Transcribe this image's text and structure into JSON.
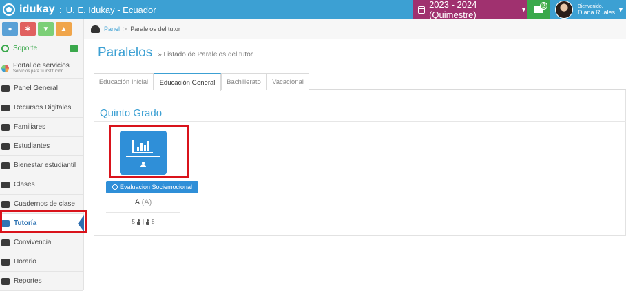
{
  "app": {
    "brand": "idukay",
    "separator": ":",
    "school": "U. E. Idukay - Ecuador"
  },
  "topbar": {
    "period_label": "2023 - 2024 (Quimestre)",
    "messages_badge": "2",
    "welcome": "Bienvenido,",
    "user_name": "Diana Ruales"
  },
  "sidebar": {
    "support": "Soporte",
    "portal_title": "Portal de servicios",
    "portal_subtitle": "Servicios para tu institución",
    "items": [
      {
        "label": "Panel General",
        "icon": "dashboard-icon"
      },
      {
        "label": "Recursos Digitales",
        "icon": "laptop-icon"
      },
      {
        "label": "Familiares",
        "icon": "user-icon"
      },
      {
        "label": "Estudiantes",
        "icon": "student-icon"
      },
      {
        "label": "Bienestar estudiantil",
        "icon": "student-wellbeing-icon"
      },
      {
        "label": "Clases",
        "icon": "flask-icon"
      },
      {
        "label": "Cuadernos de clase",
        "icon": "notebook-icon"
      },
      {
        "label": "Tutoría",
        "icon": "thumbs-up-icon"
      },
      {
        "label": "Convivencia",
        "icon": "conduct-icon"
      },
      {
        "label": "Horario",
        "icon": "calendar-icon"
      },
      {
        "label": "Reportes",
        "icon": "bar-chart-icon"
      }
    ]
  },
  "breadcrumb": {
    "home": "Panel",
    "separator": ">",
    "current": "Paralelos del tutor"
  },
  "page": {
    "title": "Paralelos",
    "subtitle": "» Listado de Paralelos del tutor"
  },
  "tabs": [
    "Educación Inicial",
    "Educación General",
    "Bachillerato",
    "Vacacional"
  ],
  "grade": {
    "title": "Quinto Grado",
    "button": "Evaluacion Sociemocional",
    "section_name": "A",
    "section_code": "(A)",
    "count_male": "5",
    "count_sep": "|",
    "count_female": "8"
  },
  "colors": {
    "topbar": "#3ca0d3",
    "period": "#a0316f",
    "messages": "#3aa84b",
    "accent": "#3ca0d3",
    "active_nav": "#3176b5",
    "highlight_box": "#d9131b"
  }
}
